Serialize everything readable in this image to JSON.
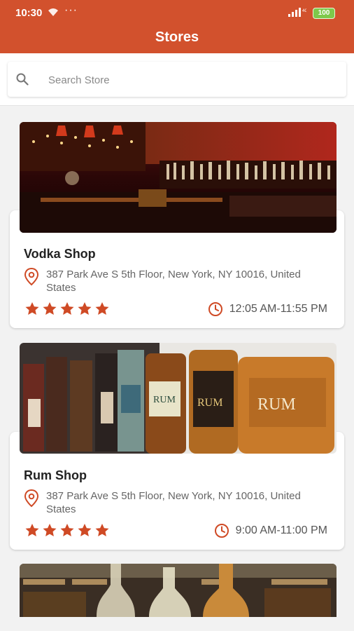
{
  "status_bar": {
    "time": "10:30",
    "dots": "···",
    "battery": "100"
  },
  "header": {
    "title": "Stores"
  },
  "search": {
    "placeholder": "Search Store"
  },
  "colors": {
    "accent": "#d2512d",
    "star": "#cf4a25"
  },
  "stores": [
    {
      "name": "Vodka Shop",
      "address": "387 Park Ave S 5th Floor, New York, NY 10016, United States",
      "rating": 5,
      "hours": "12:05 AM-11:55 PM",
      "image_icon": "bar-interior-photo"
    },
    {
      "name": "Rum Shop",
      "address": "387 Park Ave S 5th Floor, New York, NY 10016, United States",
      "rating": 5,
      "hours": "9:00 AM-11:00 PM",
      "image_icon": "rum-bottles-photo"
    },
    {
      "image_icon": "liquor-bottles-photo"
    }
  ]
}
